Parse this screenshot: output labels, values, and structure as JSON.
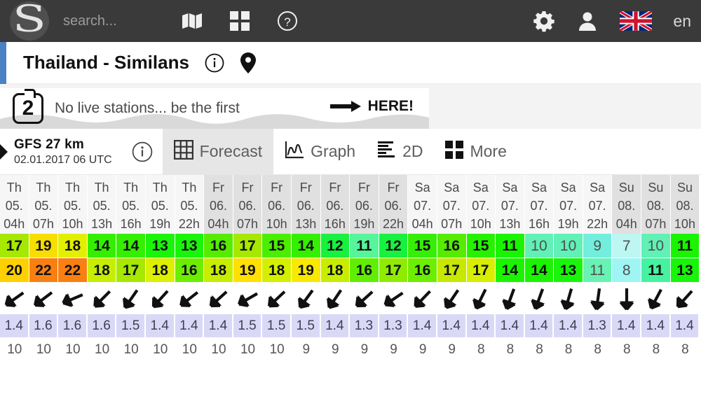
{
  "header": {
    "logo_icon": "windfinder-swirl-logo",
    "search_placeholder": "search...",
    "search_value": "",
    "icons": [
      {
        "name": "map-icon",
        "label": "Map"
      },
      {
        "name": "grid-apps-icon",
        "label": "Apps"
      },
      {
        "name": "help-circle-icon",
        "label": "Help"
      }
    ],
    "settings_icon": "gear-icon",
    "account_icon": "user-icon",
    "flag_icon": "uk-flag-icon",
    "language": "en",
    "bg_color": "#3a3a3a"
  },
  "spot": {
    "title": "Thailand - Similans",
    "info_icon": "info-circle-icon",
    "location_icon": "map-pin-icon",
    "accent_color": "#4a80c4"
  },
  "promo": {
    "badge": "2",
    "text": "No live stations... be the first",
    "arrow_icon": "arrow-right-icon",
    "cta": "HERE!"
  },
  "model": {
    "prev_icon": "chevron-left-icon",
    "name": "GFS 27 km",
    "date": "02.01.2017 06 UTC",
    "info_icon": "info-circle-icon"
  },
  "tabs": [
    {
      "label": "Forecast",
      "icon": "table-grid-icon",
      "active": true
    },
    {
      "label": "Graph",
      "icon": "line-chart-icon",
      "active": false
    },
    {
      "label": "2D",
      "icon": "bars-2d-icon",
      "active": false
    },
    {
      "label": "More",
      "icon": "grid-squares-icon",
      "active": false
    }
  ],
  "chart_data": {
    "type": "table",
    "title": "GFS 27 km wind forecast table",
    "columns": [
      {
        "day": "Th",
        "date": "05.",
        "hour": "04h",
        "weekend": false
      },
      {
        "day": "Th",
        "date": "05.",
        "hour": "07h",
        "weekend": false
      },
      {
        "day": "Th",
        "date": "05.",
        "hour": "10h",
        "weekend": false
      },
      {
        "day": "Th",
        "date": "05.",
        "hour": "13h",
        "weekend": false
      },
      {
        "day": "Th",
        "date": "05.",
        "hour": "16h",
        "weekend": false
      },
      {
        "day": "Th",
        "date": "05.",
        "hour": "19h",
        "weekend": false
      },
      {
        "day": "Th",
        "date": "05.",
        "hour": "22h",
        "weekend": false
      },
      {
        "day": "Fr",
        "date": "06.",
        "hour": "04h",
        "weekend": true
      },
      {
        "day": "Fr",
        "date": "06.",
        "hour": "07h",
        "weekend": true
      },
      {
        "day": "Fr",
        "date": "06.",
        "hour": "10h",
        "weekend": true
      },
      {
        "day": "Fr",
        "date": "06.",
        "hour": "13h",
        "weekend": true
      },
      {
        "day": "Fr",
        "date": "06.",
        "hour": "16h",
        "weekend": true
      },
      {
        "day": "Fr",
        "date": "06.",
        "hour": "19h",
        "weekend": true
      },
      {
        "day": "Fr",
        "date": "06.",
        "hour": "22h",
        "weekend": true
      },
      {
        "day": "Sa",
        "date": "07.",
        "hour": "04h",
        "weekend": false
      },
      {
        "day": "Sa",
        "date": "07.",
        "hour": "07h",
        "weekend": false
      },
      {
        "day": "Sa",
        "date": "07.",
        "hour": "10h",
        "weekend": false
      },
      {
        "day": "Sa",
        "date": "07.",
        "hour": "13h",
        "weekend": false
      },
      {
        "day": "Sa",
        "date": "07.",
        "hour": "16h",
        "weekend": false
      },
      {
        "day": "Sa",
        "date": "07.",
        "hour": "19h",
        "weekend": false
      },
      {
        "day": "Sa",
        "date": "07.",
        "hour": "22h",
        "weekend": false
      },
      {
        "day": "Su",
        "date": "08.",
        "hour": "04h",
        "weekend": true
      },
      {
        "day": "Su",
        "date": "08.",
        "hour": "07h",
        "weekend": true
      },
      {
        "day": "Su",
        "date": "08.",
        "hour": "10h",
        "weekend": true
      }
    ],
    "rows": [
      {
        "name": "wind-speed",
        "values": [
          17,
          19,
          18,
          14,
          14,
          13,
          13,
          16,
          17,
          15,
          14,
          12,
          11,
          12,
          15,
          16,
          15,
          11,
          10,
          10,
          9,
          7,
          10,
          11
        ],
        "colors": [
          "#a6e800",
          "#f7dd00",
          "#e3ef00",
          "#35ef00",
          "#35ef00",
          "#18f50a",
          "#18f50a",
          "#55ec00",
          "#a6e800",
          "#4aee00",
          "#35ef00",
          "#17f13f",
          "#56f59a",
          "#17f13f",
          "#37ef06",
          "#55ec00",
          "#26f100",
          "#1af400",
          "#61f0b6",
          "#61f0b6",
          "#73eedd",
          "#bdf6f2",
          "#61f0b6",
          "#1af400"
        ],
        "dim": [
          false,
          false,
          false,
          false,
          false,
          false,
          false,
          false,
          false,
          false,
          false,
          false,
          false,
          false,
          false,
          false,
          false,
          false,
          true,
          true,
          true,
          true,
          true,
          false
        ]
      },
      {
        "name": "wind-gusts",
        "values": [
          20,
          22,
          22,
          18,
          17,
          18,
          16,
          18,
          19,
          18,
          19,
          18,
          16,
          17,
          16,
          17,
          17,
          14,
          14,
          13,
          11,
          8,
          11,
          13
        ],
        "colors": [
          "#ffd000",
          "#f98010",
          "#f98010",
          "#c7ee00",
          "#a6e800",
          "#dcf000",
          "#6cee00",
          "#c7ee00",
          "#ffe000",
          "#d4f000",
          "#f7e900",
          "#c7ee00",
          "#60ef00",
          "#8fec00",
          "#6cee00",
          "#c7e800",
          "#d8ee00",
          "#1af400",
          "#1af400",
          "#18f50a",
          "#68f2b4",
          "#9ef5f3",
          "#45f2a0",
          "#18f50a"
        ],
        "dim": [
          false,
          false,
          false,
          false,
          false,
          false,
          false,
          false,
          false,
          false,
          false,
          false,
          false,
          false,
          false,
          false,
          false,
          false,
          false,
          false,
          true,
          true,
          false,
          false
        ]
      }
    ],
    "wind_direction_row": {
      "name": "wind-direction",
      "icon": "wind-arrow-icon",
      "bearings_deg": [
        235,
        233,
        247,
        225,
        215,
        222,
        232,
        228,
        240,
        227,
        216,
        214,
        228,
        236,
        224,
        214,
        206,
        200,
        200,
        196,
        188,
        180,
        208,
        222
      ]
    },
    "wave_height_row": {
      "name": "wave-height",
      "unit": "m",
      "values": [
        "1.4",
        "1.6",
        "1.6",
        "1.6",
        "1.5",
        "1.4",
        "1.4",
        "1.4",
        "1.5",
        "1.5",
        "1.5",
        "1.4",
        "1.3",
        "1.3",
        "1.4",
        "1.4",
        "1.4",
        "1.4",
        "1.4",
        "1.4",
        "1.3",
        "1.4",
        "1.4",
        "1.4"
      ]
    },
    "wave_period_row": {
      "name": "wave-period",
      "values": [
        "10",
        "10",
        "10",
        "10",
        "10",
        "10",
        "10",
        "10",
        "10",
        "10",
        "9",
        "9",
        "9",
        "9",
        "9",
        "9",
        "8",
        "8",
        "8",
        "8",
        "8",
        "8",
        "8",
        "8"
      ]
    }
  }
}
